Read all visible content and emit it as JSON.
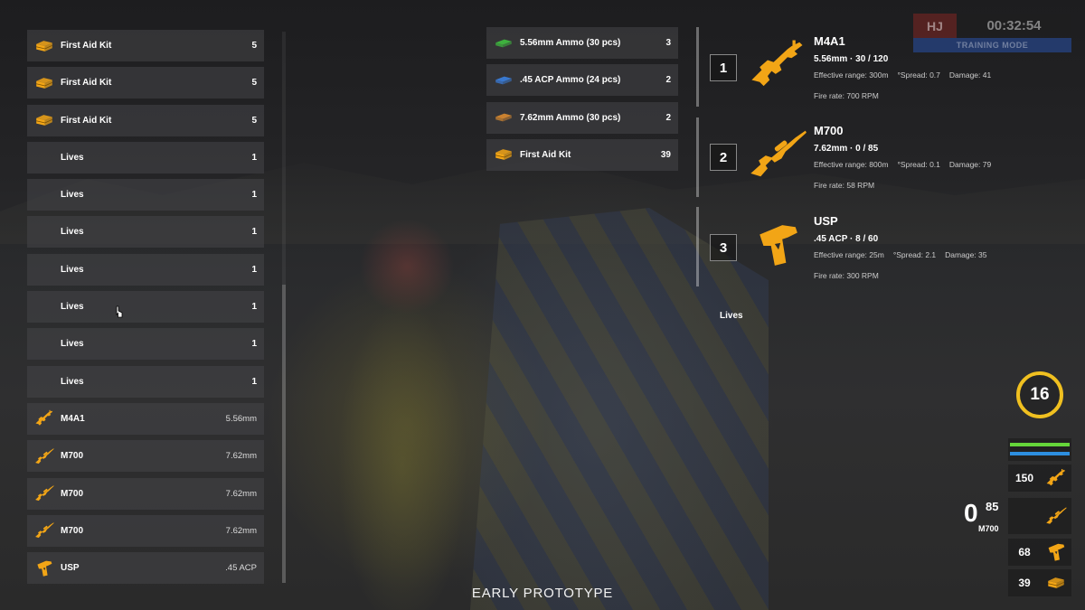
{
  "hud_timer": {
    "tag": "HJ",
    "time": "00:32:54",
    "mode": "TRAINING MODE"
  },
  "inventory": [
    {
      "name": "First Aid Kit",
      "value": "5",
      "icon": "first-aid-kit-icon"
    },
    {
      "name": "First Aid Kit",
      "value": "5",
      "icon": "first-aid-kit-icon"
    },
    {
      "name": "First Aid Kit",
      "value": "5",
      "icon": "first-aid-kit-icon"
    },
    {
      "name": "Lives",
      "value": "1",
      "icon": ""
    },
    {
      "name": "Lives",
      "value": "1",
      "icon": ""
    },
    {
      "name": "Lives",
      "value": "1",
      "icon": ""
    },
    {
      "name": "Lives",
      "value": "1",
      "icon": ""
    },
    {
      "name": "Lives",
      "value": "1",
      "icon": ""
    },
    {
      "name": "Lives",
      "value": "1",
      "icon": ""
    },
    {
      "name": "Lives",
      "value": "1",
      "icon": ""
    },
    {
      "name": "M4A1",
      "value": "5.56mm",
      "icon": "rifle-icon"
    },
    {
      "name": "M700",
      "value": "7.62mm",
      "icon": "sniper-icon"
    },
    {
      "name": "M700",
      "value": "7.62mm",
      "icon": "sniper-icon"
    },
    {
      "name": "M700",
      "value": "7.62mm",
      "icon": "sniper-icon"
    },
    {
      "name": "USP",
      "value": ".45 ACP",
      "icon": "pistol-icon"
    }
  ],
  "ground_items": [
    {
      "name": "5.56mm Ammo (30 pcs)",
      "value": "3",
      "icon": "ammo-556-icon",
      "color": "#3fbf3f"
    },
    {
      "name": ".45 ACP Ammo (24 pcs)",
      "value": "2",
      "icon": "ammo-45-icon",
      "color": "#3a7fe0"
    },
    {
      "name": "7.62mm Ammo (30 pcs)",
      "value": "2",
      "icon": "ammo-762-icon",
      "color": "#d98a30"
    },
    {
      "name": "First Aid Kit",
      "value": "39",
      "icon": "first-aid-kit-icon",
      "color": "#f2a516"
    }
  ],
  "weapon_slots": [
    {
      "num": "1",
      "name": "M4A1",
      "ammo": "5.56mm · 30 / 120",
      "range": "Effective range: 300m",
      "spread": "°Spread: 0.7",
      "damage": "Damage: 41",
      "fire_rate": "Fire rate: 700 RPM",
      "icon": "rifle-icon"
    },
    {
      "num": "2",
      "name": "M700",
      "ammo": "7.62mm · 0 / 85",
      "range": "Effective range: 800m",
      "spread": "°Spread: 0.1",
      "damage": "Damage: 79",
      "fire_rate": "Fire rate: 58 RPM",
      "icon": "sniper-icon"
    },
    {
      "num": "3",
      "name": "USP",
      "ammo": ".45 ACP · 8 / 60",
      "range": "Effective range: 25m",
      "spread": "°Spread: 2.1",
      "damage": "Damage: 35",
      "fire_rate": "Fire rate: 300 RPM",
      "icon": "pistol-icon"
    }
  ],
  "lives_label": "Lives",
  "hud": {
    "health": "16",
    "health_color": "#f0c020",
    "mag": "0",
    "reserve": "85",
    "weapon": "M700",
    "rifle_ammo": "150",
    "pistol_ammo": "68",
    "kits": "39"
  },
  "accent": "#f2a516",
  "footer": "EARLY PROTOTYPE"
}
